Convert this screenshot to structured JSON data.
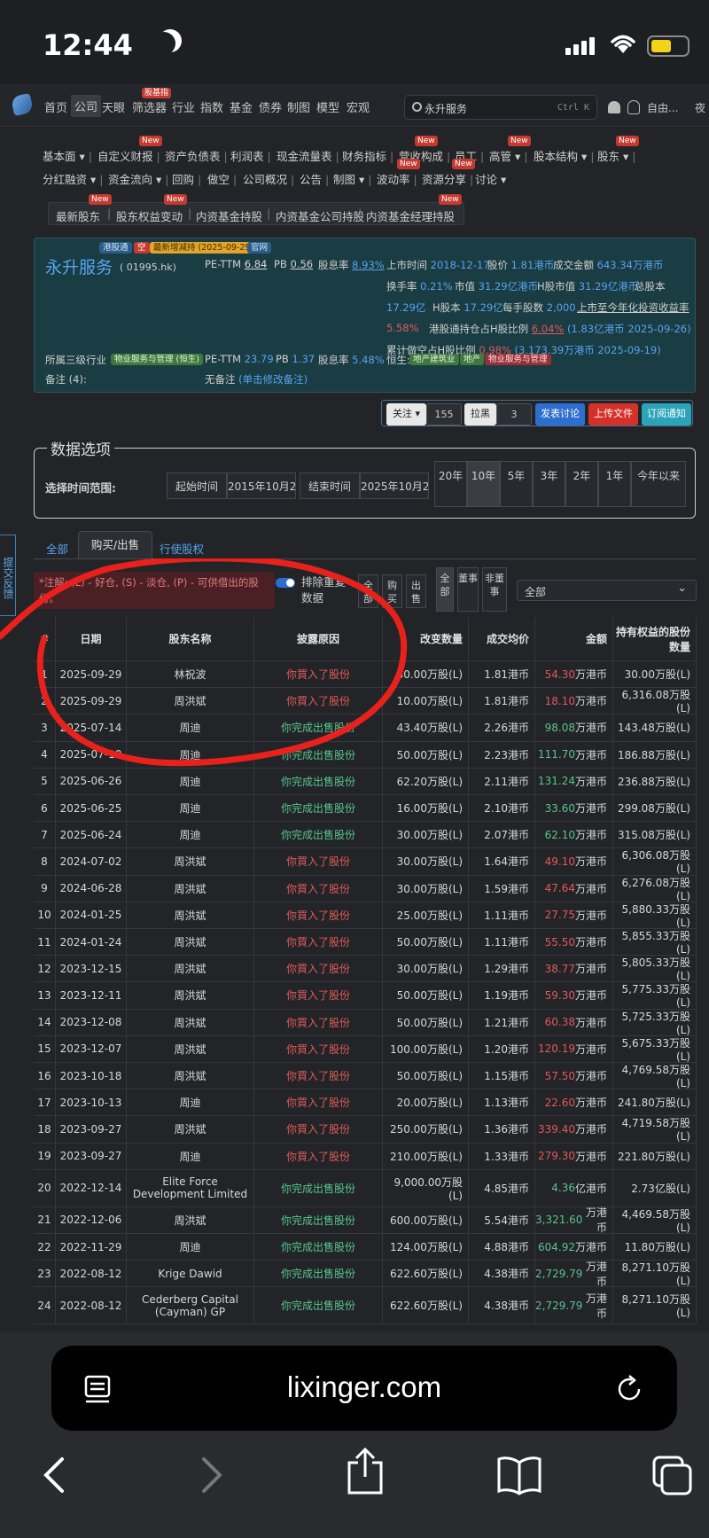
{
  "status_bar": {
    "time": "12:44"
  },
  "nav": {
    "items": [
      "首页",
      "公司",
      "天眼",
      "筛选器",
      "行业",
      "指数",
      "基金",
      "债券",
      "制图",
      "模型",
      "宏观"
    ],
    "tag_screener": "股基指",
    "search_text": "永升服务",
    "search_shortcut": "Ctrl K",
    "user": "自由...",
    "night": "夜"
  },
  "subnav_row1": [
    "基本面",
    "自定义财报",
    "资产负债表",
    "利润表",
    "现金流量表",
    "财务指标",
    "营收构成",
    "员工",
    "高管",
    "股本结构",
    "股东"
  ],
  "subnav_row2": [
    "分红融资",
    "资金流向",
    "回购",
    "做空",
    "公司概况",
    "公告",
    "制图",
    "波动率",
    "资源分享",
    "讨论"
  ],
  "subnav_row3": [
    "最新股东",
    "股东权益变动",
    "内资基金持股",
    "内资基金公司持股",
    "内资基金经理持股"
  ],
  "new_tag": "New",
  "company": {
    "tags": [
      "港股通",
      "空",
      "最新增减持 (2025-09-29)",
      "官网"
    ],
    "name": "永升服务",
    "code": "( 01995.hk)",
    "pe_label": "PE-TTM",
    "pe": "6.84",
    "pb_label": "PB",
    "pb": "0.56",
    "div_label": "股息率",
    "div": "8.93%",
    "list_label": "上市时间",
    "list_date": "2018-12-17",
    "price_label": "股价",
    "price": "1.81港币",
    "vol_label": "成交金额",
    "vol": "643.34万港币",
    "turn_label": "换手率",
    "turn": "0.21%",
    "mcap_label": "市值",
    "mcap": "31.29亿港币",
    "hmcap_label": "H股市值",
    "hmcap": "31.29亿港币",
    "total_label": "总股本",
    "total": "17.29亿",
    "hshare_label": "H股本",
    "hshare": "17.29亿",
    "lot_label": "每手股数",
    "lot": "2,000",
    "ytd_label": "上市至今年化投资收益率",
    "ytd": "5.58%",
    "sc_label": "港股通持仓占H股比例",
    "sc": "6.04%",
    "sc_detail": "(1.83亿港币  2025-09-26)",
    "short_label": "累计做空占H股比例",
    "short": "0.98%",
    "short_detail": "(3,173.39万港币  2025-09-19)",
    "ind_label": "所属三级行业",
    "ind_tag": "物业服务与管理 (恒生)",
    "pe2": "23.79",
    "pb2": "1.37",
    "div2": "5.48%",
    "hs_label": "恒生:",
    "hs_tags": [
      "地产建筑业",
      "地产",
      "物业服务与管理"
    ],
    "note_label": "备注 (4):",
    "note_text": "无备注",
    "note_link": "(单击修改备注)"
  },
  "controls": {
    "follow": "关注",
    "follow_count": "155",
    "block": "拉黑",
    "block_count": "3",
    "discuss": "发表讨论",
    "upload": "上传文件",
    "subscribe": "订阅通知"
  },
  "data_options": {
    "title": "数据选项",
    "range_label": "选择时间范围:",
    "start_label": "起始时间",
    "start": "2015年10月2日",
    "end_label": "结束时间",
    "end": "2025年10月2日",
    "years": [
      "20年",
      "10年",
      "5年",
      "3年",
      "2年",
      "1年",
      "今年以来"
    ]
  },
  "feedback": "提交反馈",
  "tabs": [
    "全部",
    "购买/出售",
    "行使股权"
  ],
  "filter": {
    "note": "*注解: (L) - 好仓, (S) - 淡仓, (P) - 可供借出的股份。",
    "dedupe": "排除重复数据",
    "btn_all": "全部",
    "btn_buy": "购买",
    "btn_sell": "出售",
    "btn_all2": "全部",
    "btn_dir": "董事",
    "btn_nondir": "非董事",
    "select": "全部"
  },
  "table": {
    "headers": [
      "#",
      "日期",
      "股东名称",
      "披露原因",
      "改变数量",
      "成交均价",
      "金额",
      "持有权益的股份数量"
    ],
    "rows": [
      [
        "1",
        "2025-09-29",
        "林祝波",
        "你買入了股份",
        "30.00万股(L)",
        "1.81港币",
        "54.30万港币",
        "30.00万股(L)",
        "b"
      ],
      [
        "2",
        "2025-09-29",
        "周洪斌",
        "你買入了股份",
        "10.00万股(L)",
        "1.81港币",
        "18.10万港币",
        "6,316.08万股(L)",
        "b"
      ],
      [
        "3",
        "2025-07-14",
        "周迪",
        "你完成出售股份",
        "43.40万股(L)",
        "2.26港币",
        "98.08万港币",
        "143.48万股(L)",
        "s"
      ],
      [
        "4",
        "2025-07-10",
        "周迪",
        "你完成出售股份",
        "50.00万股(L)",
        "2.23港币",
        "111.70万港币",
        "186.88万股(L)",
        "s"
      ],
      [
        "5",
        "2025-06-26",
        "周迪",
        "你完成出售股份",
        "62.20万股(L)",
        "2.11港币",
        "131.24万港币",
        "236.88万股(L)",
        "s"
      ],
      [
        "6",
        "2025-06-25",
        "周迪",
        "你完成出售股份",
        "16.00万股(L)",
        "2.10港币",
        "33.60万港币",
        "299.08万股(L)",
        "s"
      ],
      [
        "7",
        "2025-06-24",
        "周迪",
        "你完成出售股份",
        "30.00万股(L)",
        "2.07港币",
        "62.10万港币",
        "315.08万股(L)",
        "s"
      ],
      [
        "8",
        "2024-07-02",
        "周洪斌",
        "你買入了股份",
        "30.00万股(L)",
        "1.64港币",
        "49.10万港币",
        "6,306.08万股(L)",
        "b"
      ],
      [
        "9",
        "2024-06-28",
        "周洪斌",
        "你買入了股份",
        "30.00万股(L)",
        "1.59港币",
        "47.64万港币",
        "6,276.08万股(L)",
        "b"
      ],
      [
        "10",
        "2024-01-25",
        "周洪斌",
        "你買入了股份",
        "25.00万股(L)",
        "1.11港币",
        "27.75万港币",
        "5,880.33万股(L)",
        "b"
      ],
      [
        "11",
        "2024-01-24",
        "周洪斌",
        "你買入了股份",
        "50.00万股(L)",
        "1.11港币",
        "55.50万港币",
        "5,855.33万股(L)",
        "b"
      ],
      [
        "12",
        "2023-12-15",
        "周洪斌",
        "你買入了股份",
        "30.00万股(L)",
        "1.29港币",
        "38.77万港币",
        "5,805.33万股(L)",
        "b"
      ],
      [
        "13",
        "2023-12-11",
        "周洪斌",
        "你買入了股份",
        "50.00万股(L)",
        "1.19港币",
        "59.30万港币",
        "5,775.33万股(L)",
        "b"
      ],
      [
        "14",
        "2023-12-08",
        "周洪斌",
        "你買入了股份",
        "50.00万股(L)",
        "1.21港币",
        "60.38万港币",
        "5,725.33万股(L)",
        "b"
      ],
      [
        "15",
        "2023-12-07",
        "周洪斌",
        "你買入了股份",
        "100.00万股(L)",
        "1.20港币",
        "120.19万港币",
        "5,675.33万股(L)",
        "b"
      ],
      [
        "16",
        "2023-10-18",
        "周洪斌",
        "你買入了股份",
        "50.00万股(L)",
        "1.15港币",
        "57.50万港币",
        "4,769.58万股(L)",
        "b"
      ],
      [
        "17",
        "2023-10-13",
        "周迪",
        "你買入了股份",
        "20.00万股(L)",
        "1.13港币",
        "22.60万港币",
        "241.80万股(L)",
        "b"
      ],
      [
        "18",
        "2023-09-27",
        "周洪斌",
        "你買入了股份",
        "250.00万股(L)",
        "1.36港币",
        "339.40万港币",
        "4,719.58万股(L)",
        "b"
      ],
      [
        "19",
        "2023-09-27",
        "周迪",
        "你買入了股份",
        "210.00万股(L)",
        "1.33港币",
        "279.30万港币",
        "221.80万股(L)",
        "b"
      ],
      [
        "20",
        "2022-12-14",
        "Elite Force Development Limited",
        "你完成出售股份",
        "9,000.00万股(L)",
        "4.85港币",
        "4.36亿港币",
        "2.73亿股(L)",
        "s"
      ],
      [
        "21",
        "2022-12-06",
        "周洪斌",
        "你完成出售股份",
        "600.00万股(L)",
        "5.54港币",
        "3,321.60万港币",
        "4,469.58万股(L)",
        "s"
      ],
      [
        "22",
        "2022-11-29",
        "周迪",
        "你完成出售股份",
        "124.00万股(L)",
        "4.88港币",
        "604.92万港币",
        "11.80万股(L)",
        "s"
      ],
      [
        "23",
        "2022-08-12",
        "Krige Dawid",
        "你完成出售股份",
        "622.60万股(L)",
        "4.38港币",
        "2,729.79万港币",
        "8,271.10万股(L)",
        "s"
      ],
      [
        "24",
        "2022-08-12",
        "Cederberg Capital (Cayman) GP",
        "你完成出售股份",
        "622.60万股(L)",
        "4.38港币",
        "2,729.79万港币",
        "8,271.10万股(L)",
        "s"
      ]
    ]
  },
  "browser": {
    "url": "lixinger.com"
  },
  "colors": {
    "buy": "#e05a5a",
    "sell": "#58c58e",
    "link": "#56a4ef",
    "annotation": "#e8211d"
  }
}
